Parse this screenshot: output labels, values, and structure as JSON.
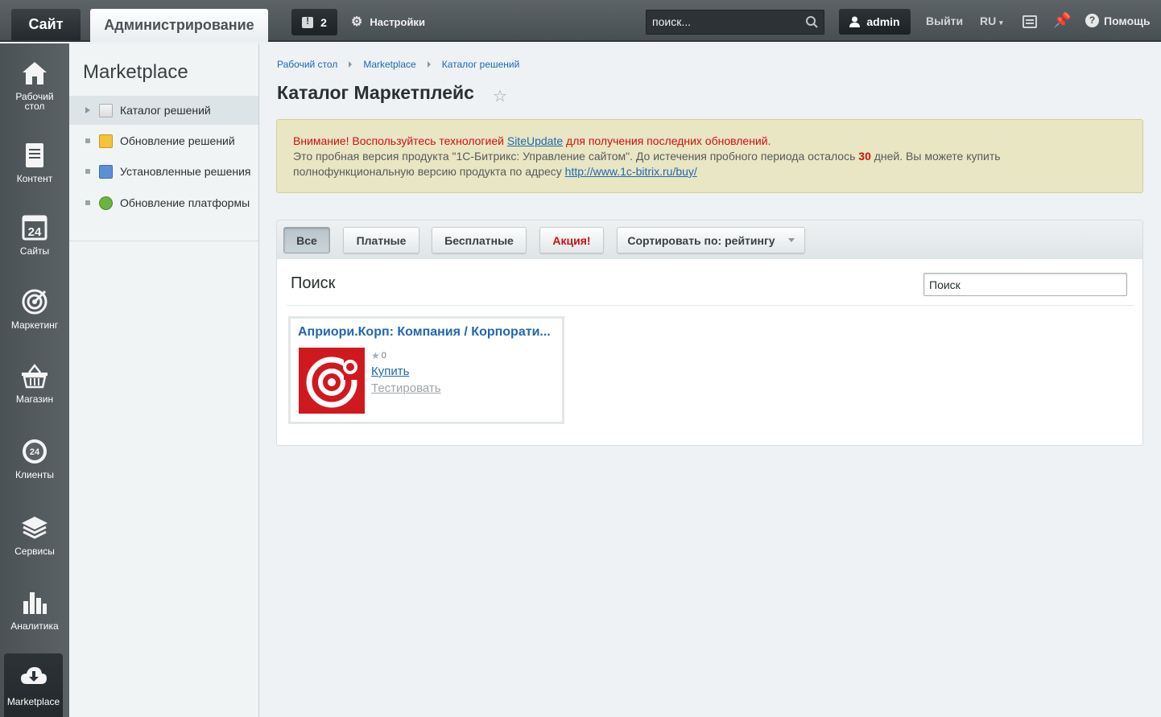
{
  "topbar": {
    "site_tab": "Сайт",
    "admin_tab": "Администрирование",
    "notifications_count": "2",
    "settings_label": "Настройки",
    "search_value": "поиск...",
    "user_name": "admin",
    "logout_label": "Выйти",
    "language": "RU",
    "help_label": "Помощь"
  },
  "leftnav": {
    "items": [
      {
        "label": "Рабочий стол",
        "icon": "home-icon"
      },
      {
        "label": "Контент",
        "icon": "document-icon"
      },
      {
        "label": "Сайты",
        "icon": "calendar-24-icon"
      },
      {
        "label": "Маркетинг",
        "icon": "target-icon"
      },
      {
        "label": "Магазин",
        "icon": "basket-icon"
      },
      {
        "label": "Клиенты",
        "icon": "clients-24-icon"
      },
      {
        "label": "Сервисы",
        "icon": "layers-icon"
      },
      {
        "label": "Аналитика",
        "icon": "bar-chart-icon"
      },
      {
        "label": "Marketplace",
        "icon": "cloud-download-icon"
      }
    ]
  },
  "subnav": {
    "title": "Marketplace",
    "items": [
      {
        "label": "Каталог решений"
      },
      {
        "label": "Обновление решений"
      },
      {
        "label": "Установленные решения"
      },
      {
        "label": "Обновление платформы"
      }
    ]
  },
  "breadcrumb": [
    "Рабочий стол",
    "Marketplace",
    "Каталог решений"
  ],
  "page_title": "Каталог Маркетплейс",
  "notice": {
    "line1_prefix": "Внимание! Воспользуйтесь технологией ",
    "line1_link": "SiteUpdate",
    "line1_suffix": " для получения последних обновлений.",
    "line2_prefix": "Это пробная версия продукта \"1С-Битрикс: Управление сайтом\". До истечения пробного периода осталось ",
    "days": "30",
    "line2_suffix": " дней. Вы можете купить",
    "line3_prefix": "полнофункциональную версию продукта по адресу ",
    "line3_link": "http://www.1c-bitrix.ru/buy/"
  },
  "filters": {
    "all": "Все",
    "paid": "Платные",
    "free": "Бесплатные",
    "promo": "Акция!",
    "sort": "Сортировать по: рейтингу"
  },
  "panel": {
    "title": "Поиск",
    "search_placeholder": "Поиск"
  },
  "card": {
    "title": "Априори.Корп: Компания / Корпорати...",
    "rating": "0",
    "buy_label": "Купить",
    "test_label": "Тестировать"
  },
  "colors": {
    "accent_link": "#2067b0",
    "warning_red": "#d01010",
    "logo_red": "#d0191f"
  }
}
